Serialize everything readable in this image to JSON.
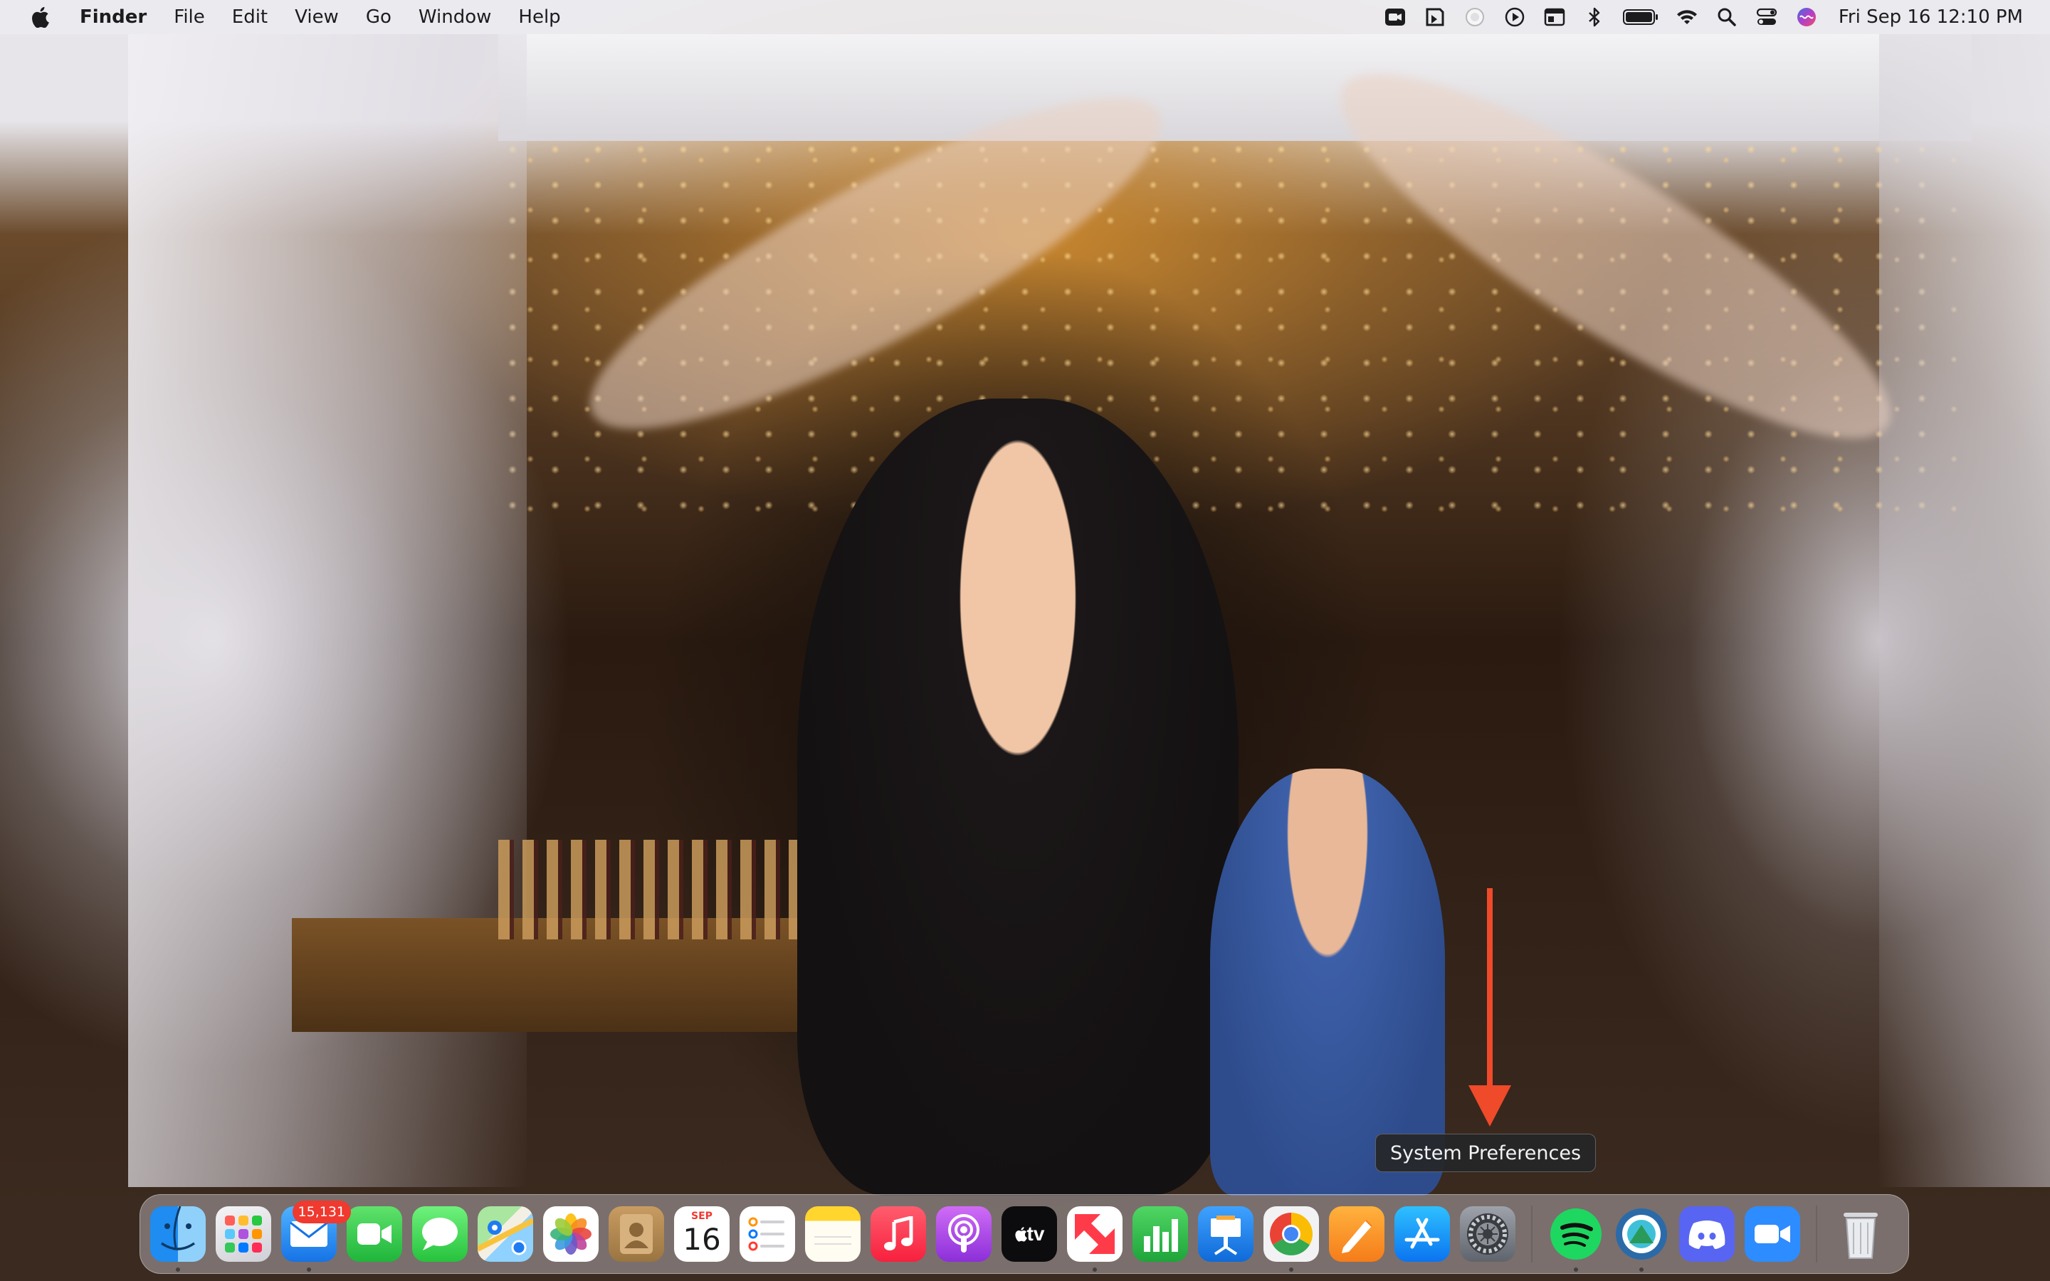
{
  "menubar": {
    "app_name": "Finder",
    "items": [
      "File",
      "Edit",
      "View",
      "Go",
      "Window",
      "Help"
    ],
    "clock": "Fri Sep 16  12:10 PM",
    "status_icons": [
      "camera-icon",
      "script-icon",
      "loading-icon",
      "play-circle-icon",
      "window-icon",
      "bluetooth-icon",
      "battery-icon",
      "wifi-icon",
      "search-icon",
      "control-center-icon",
      "siri-icon"
    ]
  },
  "tooltip": {
    "text": "System Preferences"
  },
  "annotation": {
    "arrow_color": "#ef4a2a"
  },
  "dock": {
    "apps": [
      {
        "name": "Finder",
        "icon": "finder-icon",
        "running": true
      },
      {
        "name": "Launchpad",
        "icon": "launchpad-icon",
        "running": false
      },
      {
        "name": "Mail",
        "icon": "mail-icon",
        "running": true,
        "badge": "15,131"
      },
      {
        "name": "FaceTime",
        "icon": "facetime-icon",
        "running": false
      },
      {
        "name": "Messages",
        "icon": "messages-icon",
        "running": false
      },
      {
        "name": "Maps",
        "icon": "maps-icon",
        "running": false
      },
      {
        "name": "Photos",
        "icon": "photos-icon",
        "running": false
      },
      {
        "name": "Contacts",
        "icon": "contacts-icon",
        "running": false
      },
      {
        "name": "Calendar",
        "icon": "calendar-icon",
        "running": false,
        "month": "SEP",
        "day": "16"
      },
      {
        "name": "Reminders",
        "icon": "reminders-icon",
        "running": false
      },
      {
        "name": "Notes",
        "icon": "notes-icon",
        "running": false
      },
      {
        "name": "Music",
        "icon": "music-icon",
        "running": false
      },
      {
        "name": "Podcasts",
        "icon": "podcasts-icon",
        "running": false
      },
      {
        "name": "TV",
        "icon": "apple-tv-icon",
        "running": false,
        "label": "tv"
      },
      {
        "name": "News",
        "icon": "news-icon",
        "running": true
      },
      {
        "name": "Numbers",
        "icon": "numbers-icon",
        "running": false
      },
      {
        "name": "Keynote",
        "icon": "keynote-icon",
        "running": false
      },
      {
        "name": "Google Chrome",
        "icon": "chrome-icon",
        "running": true
      },
      {
        "name": "Pages",
        "icon": "pages-icon",
        "running": false
      },
      {
        "name": "App Store",
        "icon": "app-store-icon",
        "running": false
      },
      {
        "name": "System Preferences",
        "icon": "system-preferences-icon",
        "running": false
      }
    ],
    "recent": [
      {
        "name": "Spotify",
        "icon": "spotify-icon",
        "running": true
      },
      {
        "name": "Camo",
        "icon": "camo-icon",
        "running": true
      },
      {
        "name": "Discord",
        "icon": "discord-icon",
        "running": false
      },
      {
        "name": "Zoom",
        "icon": "zoom-icon",
        "running": false
      }
    ],
    "trash": {
      "name": "Trash",
      "icon": "trash-icon"
    }
  }
}
